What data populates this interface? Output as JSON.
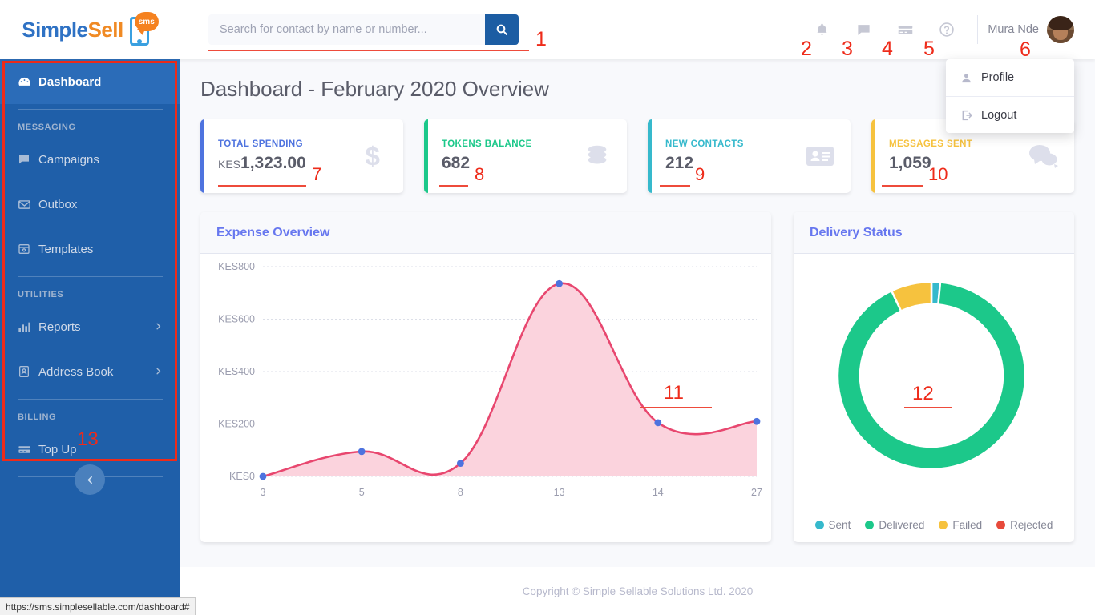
{
  "brand": {
    "name_part1": "Simple",
    "name_part2": "Sell",
    "badge": "sms"
  },
  "search": {
    "placeholder": "Search for contact by name or number...",
    "value": "",
    "button_icon": "search-icon"
  },
  "topnav": {
    "icons": [
      "bell-icon",
      "comment-icon",
      "credit-card-icon",
      "help-circle-icon"
    ],
    "user_name": "Mura Nde",
    "dropdown": [
      {
        "label": "Profile",
        "icon": "user-icon"
      },
      {
        "label": "Logout",
        "icon": "sign-out-icon"
      }
    ]
  },
  "sidebar": {
    "active": "Dashboard",
    "items": [
      {
        "label": "Dashboard",
        "icon": "gauge-icon",
        "type": "item",
        "active": true,
        "chevron": false
      },
      {
        "label": "MESSAGING",
        "type": "heading"
      },
      {
        "label": "Campaigns",
        "icon": "comment-icon",
        "type": "item",
        "chevron": false
      },
      {
        "label": "Outbox",
        "icon": "envelope-icon",
        "type": "item",
        "chevron": false
      },
      {
        "label": "Templates",
        "icon": "archive-icon",
        "type": "item",
        "chevron": false
      },
      {
        "label": "UTILITIES",
        "type": "heading"
      },
      {
        "label": "Reports",
        "icon": "chart-bar-icon",
        "type": "item",
        "chevron": true
      },
      {
        "label": "Address Book",
        "icon": "address-book-icon",
        "type": "item",
        "chevron": true
      },
      {
        "label": "BILLING",
        "type": "heading"
      },
      {
        "label": "Top Up",
        "icon": "credit-card-icon",
        "type": "item",
        "chevron": false
      }
    ],
    "collapse_icon": "chevron-left-icon"
  },
  "main": {
    "page_title": "Dashboard - February 2020 Overview",
    "cards": [
      {
        "label": "TOTAL SPENDING",
        "currency": "KES",
        "value": "1,323.00",
        "icon": "dollar-icon",
        "accent": "#4e73df"
      },
      {
        "label": "TOKENS BALANCE",
        "currency": "",
        "value": "682",
        "icon": "coins-icon",
        "accent": "#1cc88a"
      },
      {
        "label": "NEW CONTACTS",
        "currency": "",
        "value": "212",
        "icon": "id-card-icon",
        "accent": "#36b9cc"
      },
      {
        "label": "MESSAGES SENT",
        "currency": "",
        "value": "1,059",
        "icon": "comments-icon",
        "accent": "#f6c23e"
      }
    ],
    "expense_panel_title": "Expense Overview",
    "delivery_panel_title": "Delivery Status"
  },
  "chart_data": [
    {
      "type": "area",
      "title": "Expense Overview",
      "x": [
        "3",
        "5",
        "8",
        "13",
        "14",
        "27"
      ],
      "values": [
        0,
        95,
        50,
        735,
        205,
        210
      ],
      "xlabel": "",
      "ylabel": "",
      "ylim": [
        0,
        800
      ],
      "yticks": [
        0,
        200,
        400,
        600,
        800
      ],
      "ytick_labels": [
        "KES0",
        "KES200",
        "KES400",
        "KES600",
        "KES800"
      ],
      "grid": true,
      "line_color": "#e8476f",
      "fill_color": "#fbd3dd",
      "point_color": "#4e73df",
      "legend": false
    },
    {
      "type": "pie",
      "title": "Delivery Status",
      "labels": [
        "Sent",
        "Delivered",
        "Failed",
        "Rejected"
      ],
      "values": [
        1.5,
        91.5,
        7,
        0
      ],
      "colors": [
        "#36b9cc",
        "#1cc88a",
        "#f6c23e",
        "#e74a3b"
      ],
      "donut": true,
      "legend": true,
      "legend_position": "bottom"
    }
  ],
  "annotations": [
    {
      "n": "1"
    },
    {
      "n": "2"
    },
    {
      "n": "3"
    },
    {
      "n": "4"
    },
    {
      "n": "5"
    },
    {
      "n": "6"
    },
    {
      "n": "7"
    },
    {
      "n": "8"
    },
    {
      "n": "9"
    },
    {
      "n": "10"
    },
    {
      "n": "11"
    },
    {
      "n": "12"
    },
    {
      "n": "13"
    }
  ],
  "footer": {
    "text": "Copyright © Simple Sellable Solutions Ltd. 2020"
  },
  "statusbar": {
    "url": "https://sms.simplesellable.com/dashboard#"
  }
}
